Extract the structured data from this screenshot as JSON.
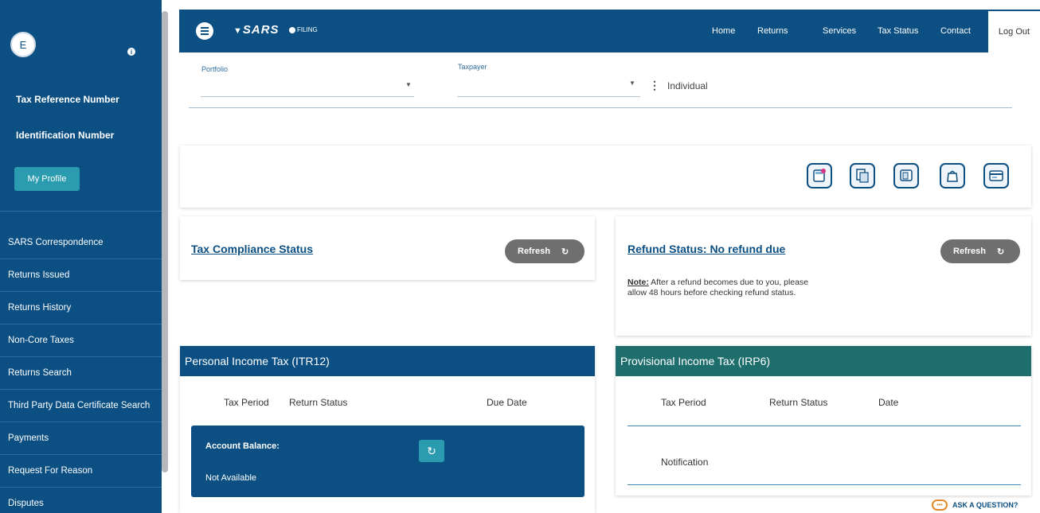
{
  "sidebar": {
    "avatar_letter": "E",
    "tax_ref_label": "Tax Reference Number",
    "id_label": "Identification Number",
    "profile_button": "My Profile",
    "items": [
      {
        "label": "SARS Correspondence"
      },
      {
        "label": "Returns Issued"
      },
      {
        "label": "Returns History"
      },
      {
        "label": "Non-Core Taxes"
      },
      {
        "label": "Returns Search"
      },
      {
        "label": "Third Party Data Certificate Search"
      },
      {
        "label": "Payments"
      },
      {
        "label": "Request For Reason"
      },
      {
        "label": "Disputes"
      }
    ]
  },
  "header": {
    "logo": "SARS",
    "sub_logo": "FILING",
    "nav": [
      "Home",
      "Returns",
      "Services",
      "Tax Status",
      "Contact"
    ],
    "logout": "Log Out"
  },
  "filters": {
    "portfolio_label": "Portfolio",
    "taxpayer_label": "Taxpayer",
    "taxpayer_type": "Individual"
  },
  "compliance": {
    "title": "Tax Compliance Status",
    "refresh": "Refresh"
  },
  "refund": {
    "title": "Refund Status: No refund due",
    "refresh": "Refresh",
    "note_label": "Note:",
    "note_text": " After a refund becomes due to you, please allow 48 hours before checking refund status."
  },
  "itr12": {
    "title": "Personal Income Tax (ITR12)",
    "col_period": "Tax Period",
    "col_status": "Return Status",
    "col_due": "Due Date",
    "account_label": "Account Balance:",
    "account_value": "Not Available"
  },
  "irp6": {
    "title": "Provisional Income Tax (IRP6)",
    "col_period": "Tax Period",
    "col_status": "Return Status",
    "col_date": "Date",
    "notification": "Notification"
  },
  "ask": {
    "label": "ASK A QUESTION?"
  },
  "colors": {
    "primary": "#0b4f83",
    "teal": "#1f6e6e",
    "accent": "#2b9bb0"
  }
}
